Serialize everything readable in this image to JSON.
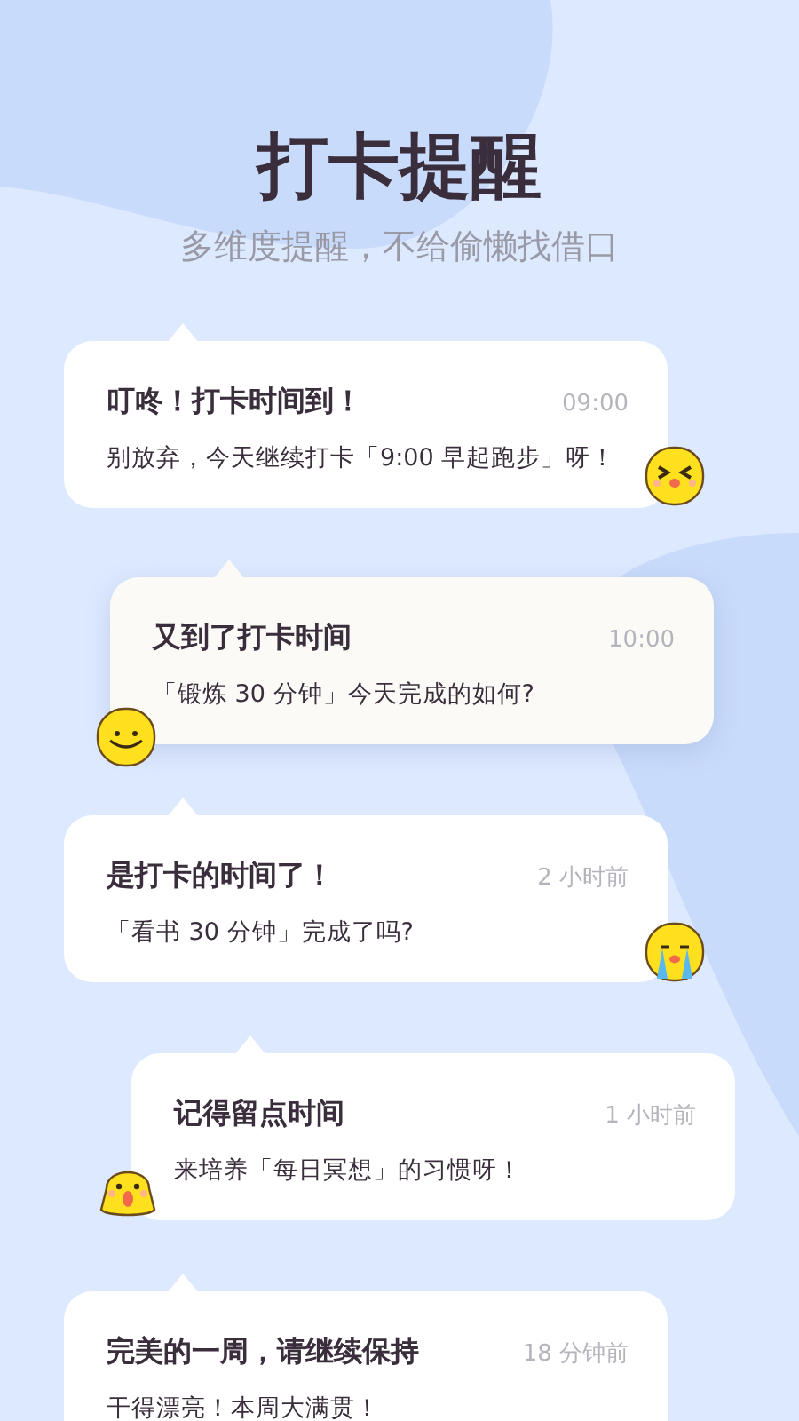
{
  "header": {
    "title": "打卡提醒",
    "subtitle": "多维度提醒，不给偷懒找借口"
  },
  "notifications": [
    {
      "title": "叮咚！打卡时间到！",
      "time": "09:00",
      "message": "别放弃，今天继续打卡「9:00 早起跑步」呀！",
      "selected": false,
      "kind": "wink"
    },
    {
      "title": "又到了打卡时间",
      "time": "10:00",
      "message": "「锻炼 30 分钟」今天完成的如何?",
      "selected": true,
      "kind": "smile"
    },
    {
      "title": "是打卡的时间了！",
      "time": "2 小时前",
      "message": "「看书 30 分钟」完成了吗?",
      "selected": false,
      "kind": "cry"
    },
    {
      "title": "记得留点时间",
      "time": "1 小时前",
      "message": "来培养「每日冥想」的习惯呀！",
      "selected": false,
      "kind": "surprised"
    },
    {
      "title": "完美的一周，请继续保持",
      "time": "18 分钟前",
      "message": "干得漂亮！本周大满贯！",
      "selected": false,
      "kind": "plain"
    }
  ]
}
